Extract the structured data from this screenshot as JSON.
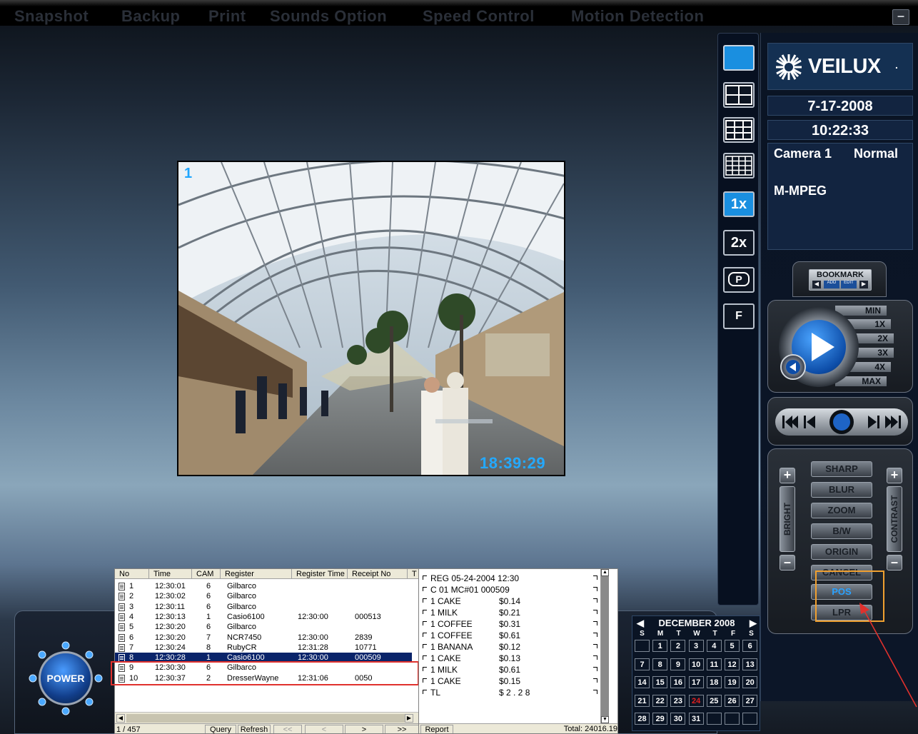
{
  "menu": {
    "items": [
      "Snapshot",
      "Backup",
      "Print",
      "Sounds Option",
      "Speed Control",
      "Motion Detection"
    ],
    "minimize": "–"
  },
  "video": {
    "camera_number": "1",
    "timestamp": "18:39:29"
  },
  "toolbar": {
    "zoom_1x": "1x",
    "zoom_2x": "2x",
    "p_label": "P",
    "f_label": "F"
  },
  "info": {
    "brand": "VEILUX",
    "brand_mark": ".",
    "date": "7-17-2008",
    "time": "10:22:33",
    "camera_label": "Camera 1",
    "camera_status": "Normal",
    "codec": "M-MPEG"
  },
  "bookmark": {
    "title": "BOOKMARK",
    "add": "ADD",
    "edit": "EDIT"
  },
  "speed": {
    "labels": [
      "MIN",
      "1X",
      "2X",
      "3X",
      "4X",
      "MAX"
    ]
  },
  "image_controls": {
    "buttons": [
      "SHARP",
      "BLUR",
      "ZOOM",
      "B/W",
      "ORIGIN",
      "CANCEL",
      "POS",
      "LPR"
    ],
    "bright": "BRIGHT",
    "contrast": "CONTRAST",
    "plus": "+",
    "minus": "–"
  },
  "power": {
    "label": "POWER"
  },
  "pos_table": {
    "headers": [
      "No",
      "Time",
      "CAM",
      "Register",
      "Register Time",
      "Receipt No",
      "T"
    ],
    "rows": [
      {
        "no": "1",
        "time": "12:30:01",
        "cam": "6",
        "register": "Gilbarco",
        "reg_time": "",
        "receipt": ""
      },
      {
        "no": "2",
        "time": "12:30:02",
        "cam": "6",
        "register": "Gilbarco",
        "reg_time": "",
        "receipt": ""
      },
      {
        "no": "3",
        "time": "12:30:11",
        "cam": "6",
        "register": "Gilbarco",
        "reg_time": "",
        "receipt": ""
      },
      {
        "no": "4",
        "time": "12:30:13",
        "cam": "1",
        "register": "Casio6100",
        "reg_time": "12:30:00",
        "receipt": "000513"
      },
      {
        "no": "5",
        "time": "12:30:20",
        "cam": "6",
        "register": "Gilbarco",
        "reg_time": "",
        "receipt": ""
      },
      {
        "no": "6",
        "time": "12:30:20",
        "cam": "7",
        "register": "NCR7450",
        "reg_time": "12:30:00",
        "receipt": "2839"
      },
      {
        "no": "7",
        "time": "12:30:24",
        "cam": "8",
        "register": "RubyCR",
        "reg_time": "12:31:28",
        "receipt": "10771"
      },
      {
        "no": "8",
        "time": "12:30:28",
        "cam": "1",
        "register": "Casio6100",
        "reg_time": "12:30:00",
        "receipt": "000509"
      },
      {
        "no": "9",
        "time": "12:30:30",
        "cam": "6",
        "register": "Gilbarco",
        "reg_time": "",
        "receipt": ""
      },
      {
        "no": "10",
        "time": "12:30:37",
        "cam": "2",
        "register": "DresserWayne",
        "reg_time": "12:31:06",
        "receipt": "0050"
      }
    ],
    "status": {
      "count": "1 / 457",
      "query": "Query",
      "refresh": "Refresh",
      "first": "<<",
      "prev": "<",
      "next": ">",
      "last": ">>"
    }
  },
  "receipt": {
    "lines": [
      {
        "left": "REG  05-24-2004 12:30",
        "right": ""
      },
      {
        "left": "C 01    MC#01    000509",
        "right": ""
      },
      {
        "left": "1 CAKE",
        "right": "$0.14"
      },
      {
        "left": "1 MILK",
        "right": "$0.21"
      },
      {
        "left": "1 COFFEE",
        "right": "$0.31"
      },
      {
        "left": "1 COFFEE",
        "right": "$0.61"
      },
      {
        "left": "1 BANANA",
        "right": "$0.12"
      },
      {
        "left": "1 CAKE",
        "right": "$0.13"
      },
      {
        "left": "1 MILK",
        "right": "$0.61"
      },
      {
        "left": "1 CAKE",
        "right": "$0.15"
      },
      {
        "left": "TL",
        "right": "$ 2 . 2 8"
      }
    ],
    "report": "Report",
    "total": "Total: 24016.19"
  },
  "calendar": {
    "month": "DECEMBER 2008",
    "days_header": [
      "S",
      "M",
      "T",
      "W",
      "T",
      "F",
      "S"
    ],
    "weeks": [
      [
        "",
        "1",
        "2",
        "3",
        "4",
        "5",
        "6"
      ],
      [
        "7",
        "8",
        "9",
        "10",
        "11",
        "12",
        "13"
      ],
      [
        "14",
        "15",
        "16",
        "17",
        "18",
        "19",
        "20"
      ],
      [
        "21",
        "22",
        "23",
        "24",
        "25",
        "26",
        "27"
      ],
      [
        "28",
        "29",
        "30",
        "31",
        "",
        "",
        ""
      ]
    ],
    "highlight_day": "24",
    "highlight_color": "#e02020"
  },
  "colors": {
    "accent": "#1fa6ff",
    "selection": "#0a246a",
    "highlight_red": "#e0312d",
    "highlight_orange": "#f0a030"
  }
}
